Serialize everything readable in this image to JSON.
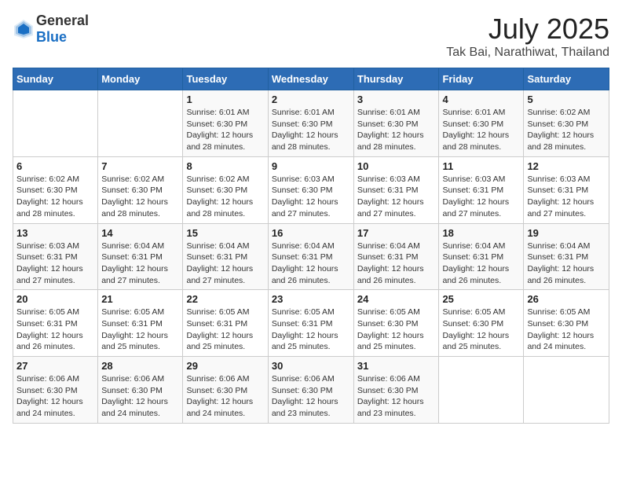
{
  "header": {
    "logo_general": "General",
    "logo_blue": "Blue",
    "title": "July 2025",
    "subtitle": "Tak Bai, Narathiwat, Thailand"
  },
  "calendar": {
    "weekdays": [
      "Sunday",
      "Monday",
      "Tuesday",
      "Wednesday",
      "Thursday",
      "Friday",
      "Saturday"
    ],
    "weeks": [
      [
        {
          "day": "",
          "info": ""
        },
        {
          "day": "",
          "info": ""
        },
        {
          "day": "1",
          "info": "Sunrise: 6:01 AM\nSunset: 6:30 PM\nDaylight: 12 hours and 28 minutes."
        },
        {
          "day": "2",
          "info": "Sunrise: 6:01 AM\nSunset: 6:30 PM\nDaylight: 12 hours and 28 minutes."
        },
        {
          "day": "3",
          "info": "Sunrise: 6:01 AM\nSunset: 6:30 PM\nDaylight: 12 hours and 28 minutes."
        },
        {
          "day": "4",
          "info": "Sunrise: 6:01 AM\nSunset: 6:30 PM\nDaylight: 12 hours and 28 minutes."
        },
        {
          "day": "5",
          "info": "Sunrise: 6:02 AM\nSunset: 6:30 PM\nDaylight: 12 hours and 28 minutes."
        }
      ],
      [
        {
          "day": "6",
          "info": "Sunrise: 6:02 AM\nSunset: 6:30 PM\nDaylight: 12 hours and 28 minutes."
        },
        {
          "day": "7",
          "info": "Sunrise: 6:02 AM\nSunset: 6:30 PM\nDaylight: 12 hours and 28 minutes."
        },
        {
          "day": "8",
          "info": "Sunrise: 6:02 AM\nSunset: 6:30 PM\nDaylight: 12 hours and 28 minutes."
        },
        {
          "day": "9",
          "info": "Sunrise: 6:03 AM\nSunset: 6:30 PM\nDaylight: 12 hours and 27 minutes."
        },
        {
          "day": "10",
          "info": "Sunrise: 6:03 AM\nSunset: 6:31 PM\nDaylight: 12 hours and 27 minutes."
        },
        {
          "day": "11",
          "info": "Sunrise: 6:03 AM\nSunset: 6:31 PM\nDaylight: 12 hours and 27 minutes."
        },
        {
          "day": "12",
          "info": "Sunrise: 6:03 AM\nSunset: 6:31 PM\nDaylight: 12 hours and 27 minutes."
        }
      ],
      [
        {
          "day": "13",
          "info": "Sunrise: 6:03 AM\nSunset: 6:31 PM\nDaylight: 12 hours and 27 minutes."
        },
        {
          "day": "14",
          "info": "Sunrise: 6:04 AM\nSunset: 6:31 PM\nDaylight: 12 hours and 27 minutes."
        },
        {
          "day": "15",
          "info": "Sunrise: 6:04 AM\nSunset: 6:31 PM\nDaylight: 12 hours and 27 minutes."
        },
        {
          "day": "16",
          "info": "Sunrise: 6:04 AM\nSunset: 6:31 PM\nDaylight: 12 hours and 26 minutes."
        },
        {
          "day": "17",
          "info": "Sunrise: 6:04 AM\nSunset: 6:31 PM\nDaylight: 12 hours and 26 minutes."
        },
        {
          "day": "18",
          "info": "Sunrise: 6:04 AM\nSunset: 6:31 PM\nDaylight: 12 hours and 26 minutes."
        },
        {
          "day": "19",
          "info": "Sunrise: 6:04 AM\nSunset: 6:31 PM\nDaylight: 12 hours and 26 minutes."
        }
      ],
      [
        {
          "day": "20",
          "info": "Sunrise: 6:05 AM\nSunset: 6:31 PM\nDaylight: 12 hours and 26 minutes."
        },
        {
          "day": "21",
          "info": "Sunrise: 6:05 AM\nSunset: 6:31 PM\nDaylight: 12 hours and 25 minutes."
        },
        {
          "day": "22",
          "info": "Sunrise: 6:05 AM\nSunset: 6:31 PM\nDaylight: 12 hours and 25 minutes."
        },
        {
          "day": "23",
          "info": "Sunrise: 6:05 AM\nSunset: 6:31 PM\nDaylight: 12 hours and 25 minutes."
        },
        {
          "day": "24",
          "info": "Sunrise: 6:05 AM\nSunset: 6:30 PM\nDaylight: 12 hours and 25 minutes."
        },
        {
          "day": "25",
          "info": "Sunrise: 6:05 AM\nSunset: 6:30 PM\nDaylight: 12 hours and 25 minutes."
        },
        {
          "day": "26",
          "info": "Sunrise: 6:05 AM\nSunset: 6:30 PM\nDaylight: 12 hours and 24 minutes."
        }
      ],
      [
        {
          "day": "27",
          "info": "Sunrise: 6:06 AM\nSunset: 6:30 PM\nDaylight: 12 hours and 24 minutes."
        },
        {
          "day": "28",
          "info": "Sunrise: 6:06 AM\nSunset: 6:30 PM\nDaylight: 12 hours and 24 minutes."
        },
        {
          "day": "29",
          "info": "Sunrise: 6:06 AM\nSunset: 6:30 PM\nDaylight: 12 hours and 24 minutes."
        },
        {
          "day": "30",
          "info": "Sunrise: 6:06 AM\nSunset: 6:30 PM\nDaylight: 12 hours and 23 minutes."
        },
        {
          "day": "31",
          "info": "Sunrise: 6:06 AM\nSunset: 6:30 PM\nDaylight: 12 hours and 23 minutes."
        },
        {
          "day": "",
          "info": ""
        },
        {
          "day": "",
          "info": ""
        }
      ]
    ]
  }
}
